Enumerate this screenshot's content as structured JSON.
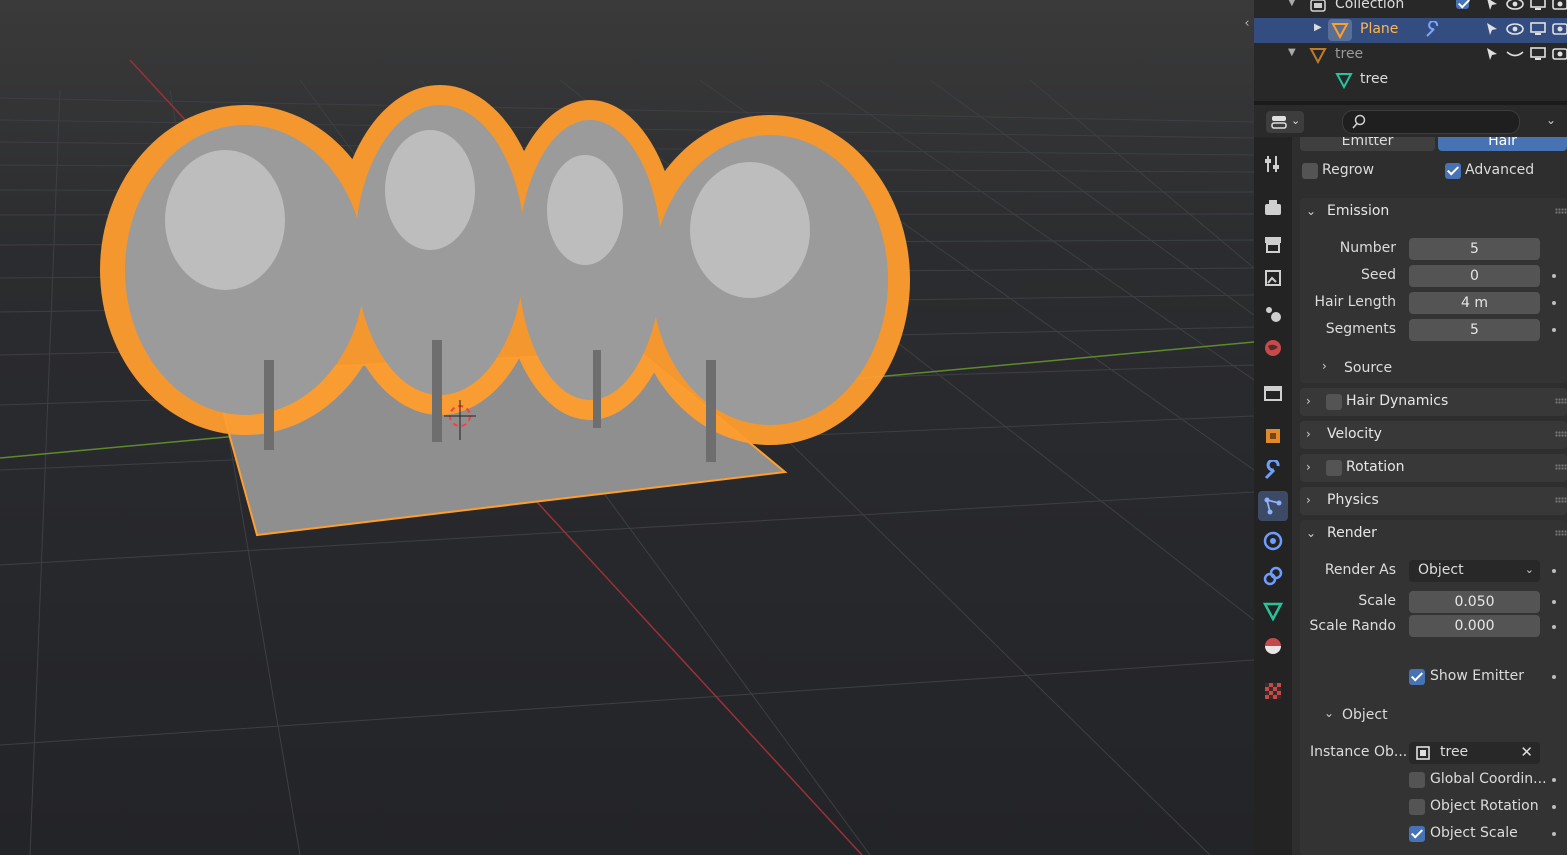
{
  "outliner": {
    "rows": [
      {
        "label": "Collection"
      },
      {
        "label": "Plane"
      },
      {
        "label": "tree"
      },
      {
        "label": "tree"
      }
    ]
  },
  "properties": {
    "source_tabs": {
      "emitter": "Emitter",
      "hair": "Hair"
    },
    "regrow_label": "Regrow",
    "advanced_label": "Advanced",
    "emission": {
      "title": "Emission",
      "number_label": "Number",
      "number_value": "5",
      "seed_label": "Seed",
      "seed_value": "0",
      "hair_length_label": "Hair Length",
      "hair_length_value": "4 m",
      "segments_label": "Segments",
      "segments_value": "5",
      "source_label": "Source"
    },
    "hair_dynamics": "Hair Dynamics",
    "velocity": "Velocity",
    "rotation": "Rotation",
    "physics": "Physics",
    "render": {
      "title": "Render",
      "render_as_label": "Render As",
      "render_as_value": "Object",
      "scale_label": "Scale",
      "scale_value": "0.050",
      "scale_random_label": "Scale Rando",
      "scale_random_value": "0.000",
      "show_emitter_label": "Show Emitter",
      "object_section": "Object",
      "instance_label": "Instance Ob...",
      "instance_value": "tree",
      "global_coord_label": "Global Coordin...",
      "object_rotation_label": "Object Rotation",
      "object_scale_label": "Object Scale"
    }
  },
  "colors": {
    "accent": "#4772b3",
    "selection": "#ff9d2e",
    "header_selected": "#334d80"
  }
}
